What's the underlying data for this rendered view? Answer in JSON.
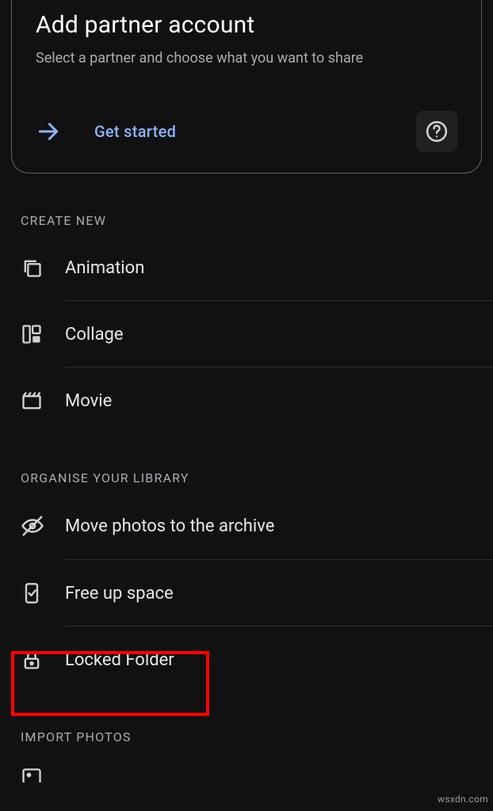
{
  "card": {
    "title": "Add partner account",
    "subtitle": "Select a partner and choose what you want to share",
    "getStarted": "Get started"
  },
  "sections": {
    "createNew": "CREATE NEW",
    "organise": "ORGANISE YOUR LIBRARY",
    "import": "IMPORT PHOTOS"
  },
  "create": {
    "animation": "Animation",
    "collage": "Collage",
    "movie": "Movie"
  },
  "organise": {
    "archive": "Move photos to the archive",
    "freeup": "Free up space",
    "locked": "Locked Folder"
  },
  "watermark": "wsxdn.com"
}
